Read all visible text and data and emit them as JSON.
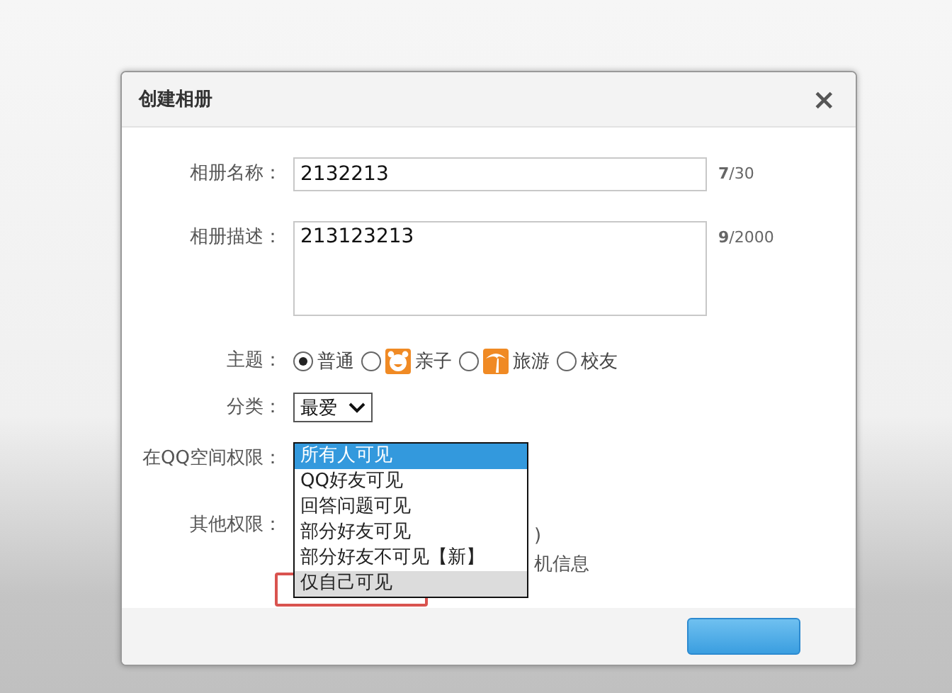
{
  "dialog": {
    "title": "创建相册",
    "close": "×"
  },
  "name_field": {
    "label": "相册名称：",
    "value": "2132213",
    "counter": "**7**/30"
  },
  "description_field": {
    "label": "相册描述：",
    "value": "213123213",
    "counter": "**9**/2000"
  },
  "theme": {
    "label": "主题：",
    "options": [
      {
        "label": "普通",
        "selected": true,
        "kind": "plain"
      },
      {
        "label": "亲子",
        "selected": false,
        "kind": "face"
      },
      {
        "label": "旅游",
        "selected": false,
        "kind": "palm"
      },
      {
        "label": "校友",
        "selected": false,
        "kind": "plain"
      }
    ]
  },
  "category": {
    "label": "分类：",
    "value": "最爱"
  },
  "qzone_permission": {
    "label": "在QQ空间权限：",
    "options": [
      {
        "label": "所有人可见",
        "selected": true,
        "hovered": false,
        "highlighted": false
      },
      {
        "label": "QQ好友可见",
        "selected": false,
        "hovered": false,
        "highlighted": false
      },
      {
        "label": "回答问题可见",
        "selected": false,
        "hovered": false,
        "highlighted": false
      },
      {
        "label": "部分好友可见",
        "selected": false,
        "hovered": false,
        "highlighted": false
      },
      {
        "label": "部分好友不可见【新】",
        "selected": false,
        "hovered": false,
        "highlighted": false
      },
      {
        "label": "仅自己可见",
        "selected": false,
        "hovered": true,
        "highlighted": true
      }
    ]
  },
  "other_permissions": {
    "label": "其他权限：",
    "fragments": [
      ")",
      "机信息"
    ]
  }
}
